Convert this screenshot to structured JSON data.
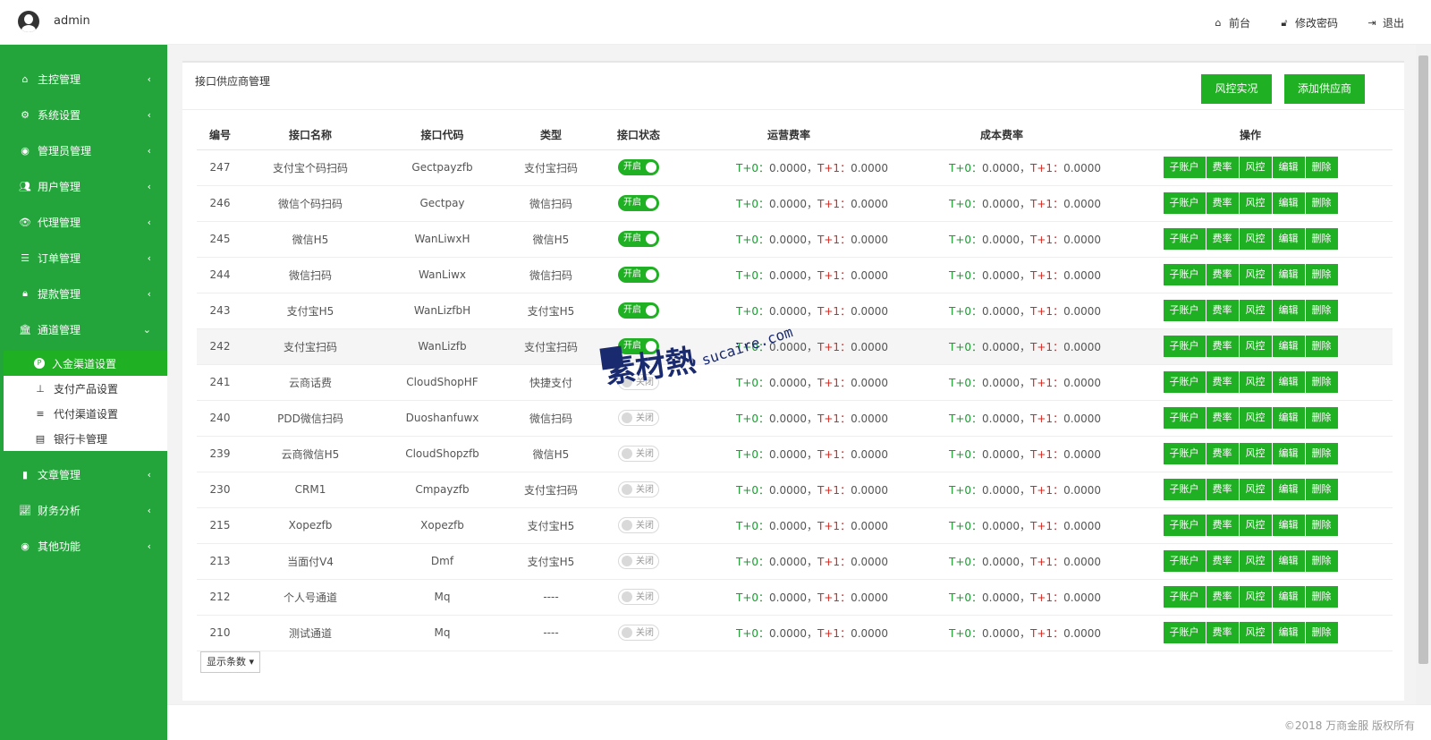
{
  "header": {
    "user": "admin",
    "links": [
      {
        "icon": "home-icon",
        "label": "前台"
      },
      {
        "icon": "lock-icon",
        "label": "修改密码"
      },
      {
        "icon": "logout-icon",
        "label": "退出"
      }
    ]
  },
  "sidebar": {
    "items": [
      {
        "label": "主控管理",
        "icon": "home-icon",
        "arrow": "‹"
      },
      {
        "label": "系统设置",
        "icon": "gears-icon",
        "arrow": "‹"
      },
      {
        "label": "管理员管理",
        "icon": "user-circle-icon",
        "arrow": "‹"
      },
      {
        "label": "用户管理",
        "icon": "users-icon",
        "arrow": "‹"
      },
      {
        "label": "代理管理",
        "icon": "eye-icon",
        "arrow": "‹"
      },
      {
        "label": "订单管理",
        "icon": "list-icon",
        "arrow": "‹"
      },
      {
        "label": "提款管理",
        "icon": "lock-icon",
        "arrow": "‹"
      },
      {
        "label": "通道管理",
        "icon": "bank-icon",
        "arrow": "⌄"
      },
      {
        "label": "文章管理",
        "icon": "book-icon",
        "arrow": "‹"
      },
      {
        "label": "财务分析",
        "icon": "chart-icon",
        "arrow": "‹"
      },
      {
        "label": "其他功能",
        "icon": "user-circle-icon",
        "arrow": "‹"
      }
    ],
    "submenu": [
      {
        "label": "入金渠道设置",
        "icon": "p-circle-icon",
        "active": true
      },
      {
        "label": "支付产品设置",
        "icon": "sitemap-icon",
        "active": false
      },
      {
        "label": "代付渠道设置",
        "icon": "sliders-icon",
        "active": false
      },
      {
        "label": "银行卡管理",
        "icon": "card-icon",
        "active": false
      }
    ]
  },
  "panel": {
    "title": "接口供应商管理",
    "btn_risk": "风控实况",
    "btn_add": "添加供应商"
  },
  "table": {
    "headers": [
      "编号",
      "接口名称",
      "接口代码",
      "类型",
      "接口状态",
      "运营费率",
      "成本费率",
      "操作"
    ],
    "fee_labels": {
      "t0": "T+0：",
      "t1": "T+1：",
      "sep": "，"
    },
    "ops": [
      "子账户",
      "费率",
      "风控",
      "编辑",
      "删除"
    ],
    "toggle_on": "开启",
    "toggle_off": "关闭",
    "rows": [
      {
        "id": "247",
        "name": "支付宝个码扫码",
        "code": "Gectpayzfb",
        "type": "支付宝扫码",
        "on": true,
        "run_t0": "0.0000",
        "run_t1": "0.0000",
        "cost_t0": "0.0000",
        "cost_t1": "0.0000"
      },
      {
        "id": "246",
        "name": "微信个码扫码",
        "code": "Gectpay",
        "type": "微信扫码",
        "on": true,
        "run_t0": "0.0000",
        "run_t1": "0.0000",
        "cost_t0": "0.0000",
        "cost_t1": "0.0000"
      },
      {
        "id": "245",
        "name": "微信H5",
        "code": "WanLiwxH",
        "type": "微信H5",
        "on": true,
        "run_t0": "0.0000",
        "run_t1": "0.0000",
        "cost_t0": "0.0000",
        "cost_t1": "0.0000"
      },
      {
        "id": "244",
        "name": "微信扫码",
        "code": "WanLiwx",
        "type": "微信扫码",
        "on": true,
        "run_t0": "0.0000",
        "run_t1": "0.0000",
        "cost_t0": "0.0000",
        "cost_t1": "0.0000"
      },
      {
        "id": "243",
        "name": "支付宝H5",
        "code": "WanLizfbH",
        "type": "支付宝H5",
        "on": true,
        "run_t0": "0.0000",
        "run_t1": "0.0000",
        "cost_t0": "0.0000",
        "cost_t1": "0.0000"
      },
      {
        "id": "242",
        "name": "支付宝扫码",
        "code": "WanLizfb",
        "type": "支付宝扫码",
        "on": true,
        "run_t0": "0.0000",
        "run_t1": "0.0000",
        "cost_t0": "0.0000",
        "cost_t1": "0.0000"
      },
      {
        "id": "241",
        "name": "云商话费",
        "code": "CloudShopHF",
        "type": "快捷支付",
        "on": false,
        "run_t0": "0.0000",
        "run_t1": "0.0000",
        "cost_t0": "0.0000",
        "cost_t1": "0.0000"
      },
      {
        "id": "240",
        "name": "PDD微信扫码",
        "code": "Duoshanfuwx",
        "type": "微信扫码",
        "on": false,
        "run_t0": "0.0000",
        "run_t1": "0.0000",
        "cost_t0": "0.0000",
        "cost_t1": "0.0000"
      },
      {
        "id": "239",
        "name": "云商微信H5",
        "code": "CloudShopzfb",
        "type": "微信H5",
        "on": false,
        "run_t0": "0.0000",
        "run_t1": "0.0000",
        "cost_t0": "0.0000",
        "cost_t1": "0.0000"
      },
      {
        "id": "230",
        "name": "CRM1",
        "code": "Cmpayzfb",
        "type": "支付宝扫码",
        "on": false,
        "run_t0": "0.0000",
        "run_t1": "0.0000",
        "cost_t0": "0.0000",
        "cost_t1": "0.0000"
      },
      {
        "id": "215",
        "name": "Xopezfb",
        "code": "Xopezfb",
        "type": "支付宝H5",
        "on": false,
        "run_t0": "0.0000",
        "run_t1": "0.0000",
        "cost_t0": "0.0000",
        "cost_t1": "0.0000"
      },
      {
        "id": "213",
        "name": "当面付V4",
        "code": "Dmf",
        "type": "支付宝H5",
        "on": false,
        "run_t0": "0.0000",
        "run_t1": "0.0000",
        "cost_t0": "0.0000",
        "cost_t1": "0.0000"
      },
      {
        "id": "212",
        "name": "个人号通道",
        "code": "Mq",
        "type": "----",
        "on": false,
        "run_t0": "0.0000",
        "run_t1": "0.0000",
        "cost_t0": "0.0000",
        "cost_t1": "0.0000"
      },
      {
        "id": "210",
        "name": "测试通道",
        "code": "Mq",
        "type": "----",
        "on": false,
        "run_t0": "0.0000",
        "run_t1": "0.0000",
        "cost_t0": "0.0000",
        "cost_t1": "0.0000"
      }
    ]
  },
  "pager": {
    "label": "显示条数 ▾"
  },
  "footer": {
    "copyright": "©2018 万商金服 版权所有"
  },
  "watermark": {
    "big": "素材熱",
    "url": "sucaire.com"
  },
  "colors": {
    "brand": "#24a53b",
    "button": "#20b023",
    "t0": "#1b9a30",
    "t1": "#d9271e"
  }
}
